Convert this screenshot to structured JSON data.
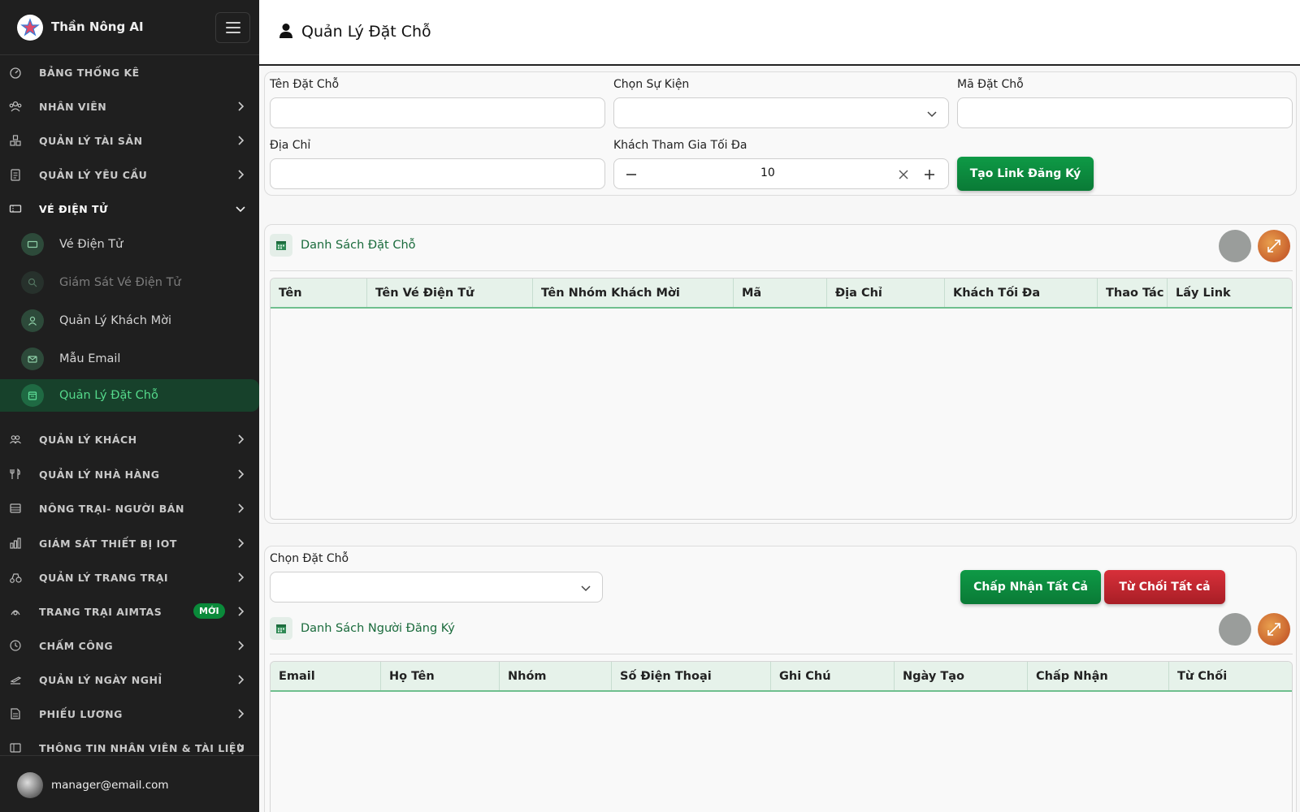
{
  "app": {
    "name": "Thần Nông AI"
  },
  "sidebar": {
    "items": [
      {
        "label": "BẢNG THỐNG KÊ",
        "icon": "dashboard-icon"
      },
      {
        "label": "NHÂN VIÊN",
        "icon": "staff-icon"
      },
      {
        "label": "QUẢN LÝ TÀI SẢN",
        "icon": "assets-icon"
      },
      {
        "label": "QUẢN LÝ YÊU CẦU",
        "icon": "requests-icon"
      },
      {
        "label": "VÉ ĐIỆN TỬ",
        "icon": "ticket-icon"
      },
      {
        "label": "QUẢN LÝ KHÁCH",
        "icon": "guests-icon"
      },
      {
        "label": "QUẢN LÝ NHÀ HÀNG",
        "icon": "restaurant-icon"
      },
      {
        "label": "NÔNG TRẠI- NGƯỜI BÁN",
        "icon": "farm-seller-icon"
      },
      {
        "label": "GIÁM SÁT THIẾT BỊ IOT",
        "icon": "iot-icon"
      },
      {
        "label": "QUẢN LÝ TRANG TRẠI",
        "icon": "farm-icon"
      },
      {
        "label": "TRANG TRẠI AIMTAS",
        "icon": "aimtas-icon",
        "badge": "MỚI"
      },
      {
        "label": "CHẤM CÔNG",
        "icon": "clock-icon"
      },
      {
        "label": "QUẢN LÝ NGÀY NGHỈ",
        "icon": "leave-icon"
      },
      {
        "label": "PHIẾU LƯƠNG",
        "icon": "payslip-icon"
      },
      {
        "label": "THÔNG TIN NHÂN VIÊN & TÀI LIỆU",
        "icon": "documents-icon"
      }
    ],
    "subitems": [
      {
        "label": "Vé Điện Tử"
      },
      {
        "label": "Giám Sát Vé Điện Tử"
      },
      {
        "label": "Quản Lý Khách Mời"
      },
      {
        "label": "Mẫu Email"
      },
      {
        "label": "Quản Lý Đặt Chỗ"
      }
    ]
  },
  "user": {
    "email": "manager@email.com"
  },
  "page": {
    "title": "Quản Lý Đặt Chỗ"
  },
  "form": {
    "name_label": "Tên Đặt Chỗ",
    "name_value": "",
    "event_label": "Chọn Sự Kiện",
    "event_value": "",
    "code_label": "Mã Đặt Chỗ",
    "code_value": "",
    "address_label": "Địa Chỉ",
    "address_value": "",
    "max_label": "Khách Tham Gia Tối Đa",
    "max_value": "10",
    "create_link_button": "Tạo Link Đăng Ký"
  },
  "booking_list": {
    "title": "Danh Sách Đặt Chỗ",
    "columns": [
      "Tên",
      "Tên Vé Điện Tử",
      "Tên Nhóm Khách Mời",
      "Mã",
      "Địa Chỉ",
      "Khách Tối Đa",
      "Thao Tác",
      "Lấy Link"
    ],
    "rows": []
  },
  "registrants": {
    "select_label": "Chọn Đặt Chỗ",
    "select_value": "",
    "accept_all_button": "Chấp Nhận Tất Cả",
    "reject_all_button": "Từ Chối Tất cả",
    "title": "Danh Sách Người Đăng Ký",
    "columns": [
      "Email",
      "Họ Tên",
      "Nhóm",
      "Số Điện Thoại",
      "Ghi Chú",
      "Ngày Tạo",
      "Chấp Nhận",
      "Từ Chối"
    ],
    "rows": []
  }
}
